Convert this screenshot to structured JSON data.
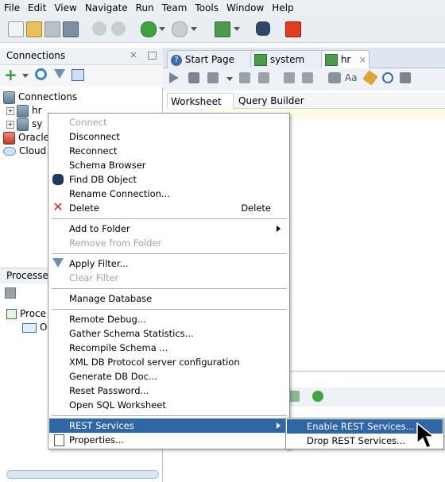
{
  "menubar": [
    "File",
    "Edit",
    "View",
    "Navigate",
    "Run",
    "Team",
    "Tools",
    "Window",
    "Help"
  ],
  "connections": {
    "title": "Connections",
    "root": "Connections",
    "items": [
      "hr",
      "sy",
      "Oracle",
      "Cloud"
    ]
  },
  "processes": {
    "title": "Processe",
    "node": "Proce",
    "child": "O"
  },
  "tabs": [
    {
      "label": "Start Page",
      "icon": "help-icon"
    },
    {
      "label": "system",
      "icon": "sql-connection-icon"
    },
    {
      "label": "hr",
      "icon": "sql-connection-icon"
    }
  ],
  "subtabs": [
    "Worksheet",
    "Query Builder"
  ],
  "context_menu": {
    "items": [
      {
        "label": "Connect",
        "disabled": true
      },
      {
        "label": "Disconnect"
      },
      {
        "label": "Reconnect"
      },
      {
        "label": "Schema Browser"
      },
      {
        "label": "Find DB Object",
        "icon": "binoculars-icon"
      },
      {
        "label": "Rename Connection..."
      },
      {
        "label": "Delete",
        "accel": "Delete",
        "icon": "delete-x-icon"
      },
      {
        "label": "Add to Folder",
        "submenu": true
      },
      {
        "label": "Remove from Folder",
        "disabled": true
      },
      {
        "label": "Apply Filter...",
        "icon": "filter-icon"
      },
      {
        "label": "Clear Filter",
        "disabled": true
      },
      {
        "label": "Manage Database"
      },
      {
        "label": "Remote Debug..."
      },
      {
        "label": "Gather Schema Statistics..."
      },
      {
        "label": "Recompile Schema ..."
      },
      {
        "label": "XML DB Protocol server configuration"
      },
      {
        "label": "Generate DB Doc..."
      },
      {
        "label": "Reset Password..."
      },
      {
        "label": "Open SQL Worksheet"
      },
      {
        "label": "REST Services",
        "submenu": true,
        "highlighted": true
      },
      {
        "label": "Properties...",
        "icon": "properties-icon"
      }
    ]
  },
  "submenu": {
    "items": [
      {
        "label": "Enable REST Services...",
        "highlighted": true
      },
      {
        "label": "Drop REST Services..."
      }
    ]
  },
  "colors": {
    "highlight": "#2f66a6",
    "disabled_text": "#9da3a9"
  }
}
